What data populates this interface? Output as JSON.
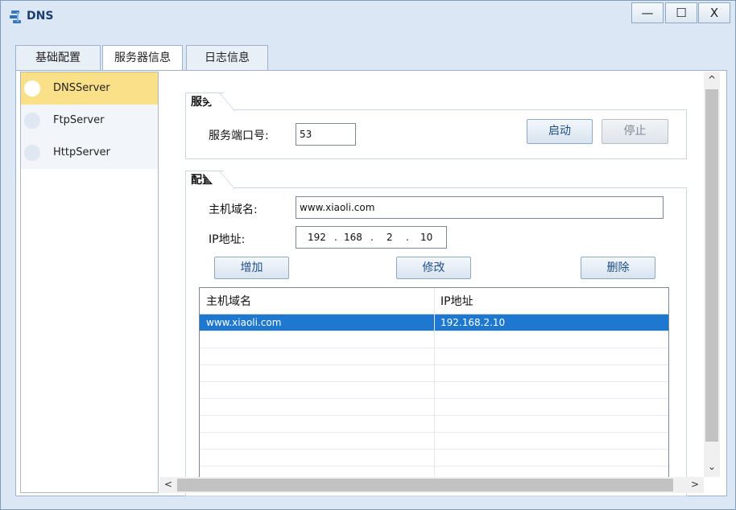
{
  "window": {
    "title": "DNS",
    "icon": "dns-app-icon",
    "controls": {
      "minimize": "—",
      "maximize": "☐",
      "close": "X"
    }
  },
  "tabs": [
    {
      "label": "基础配置",
      "active": false
    },
    {
      "label": "服务器信息",
      "active": true
    },
    {
      "label": "日志信息",
      "active": false
    }
  ],
  "sidebar": {
    "items": [
      {
        "label": "DNSServer",
        "active": true
      },
      {
        "label": "FtpServer",
        "active": false
      },
      {
        "label": "HttpServer",
        "active": false
      }
    ]
  },
  "service": {
    "group_label": "服务",
    "port_label": "服务端口号:",
    "port_value": "53",
    "start_button": "启动",
    "stop_button": "停止"
  },
  "config": {
    "group_label": "配置",
    "hostname_label": "主机域名:",
    "hostname_value": "www.xiaoli.com",
    "ip_label": "IP地址:",
    "ip_parts": [
      "192",
      "168",
      "2",
      "10"
    ],
    "ip_separator": ".",
    "add_button": "增加",
    "modify_button": "修改",
    "delete_button": "删除"
  },
  "table": {
    "columns": [
      "主机域名",
      "IP地址"
    ],
    "rows": [
      {
        "hostname": "www.xiaoli.com",
        "ip": "192.168.2.10",
        "selected": true
      }
    ]
  },
  "colors": {
    "selection": "#1e78d0",
    "active_sidebar": "#fbe08a",
    "button_text": "#1f4f86"
  }
}
